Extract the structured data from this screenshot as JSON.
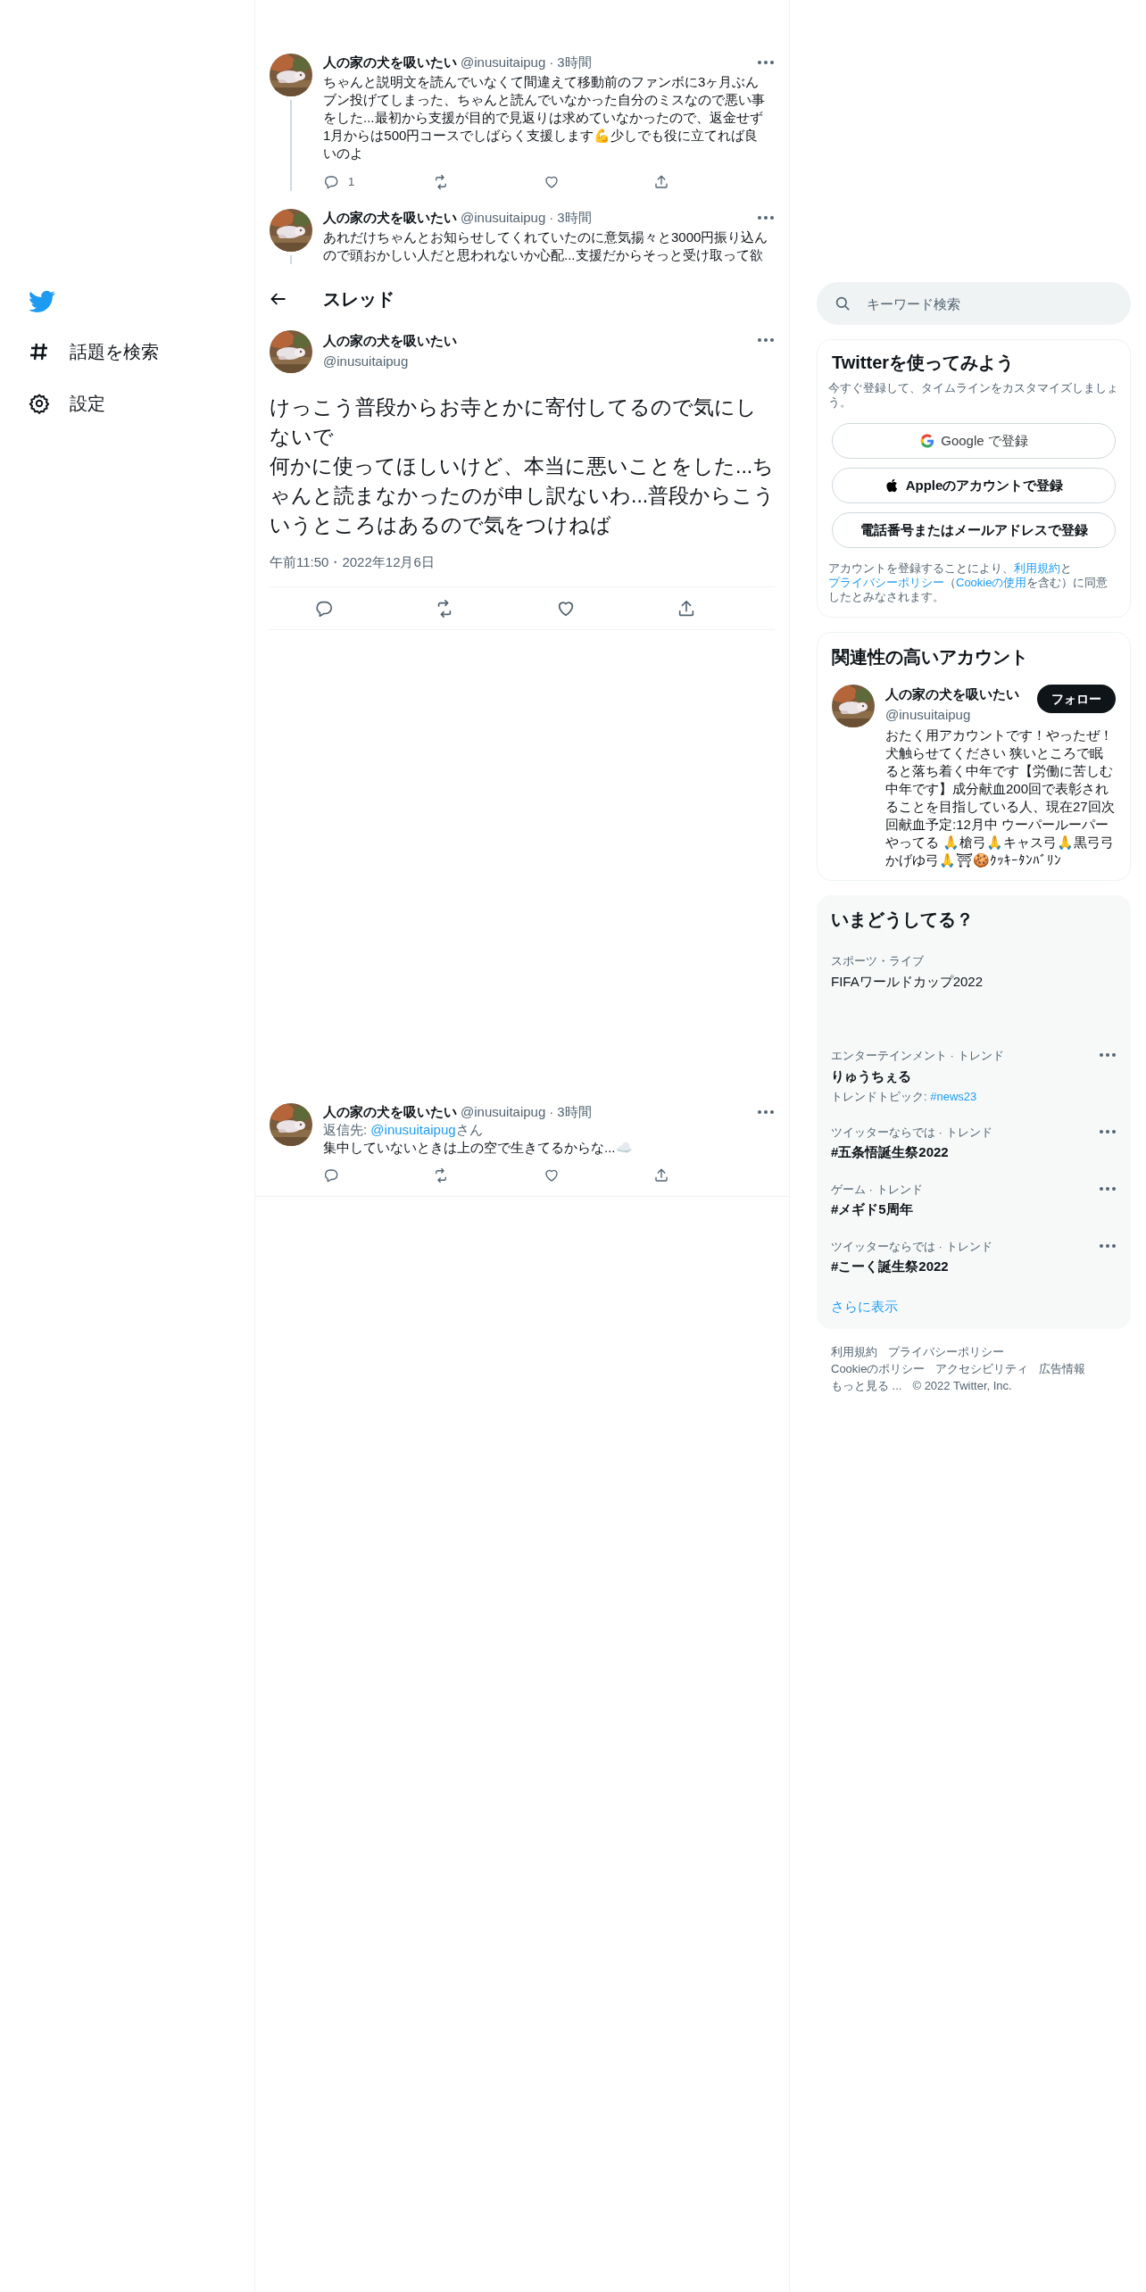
{
  "sidebar": {
    "items": [
      {
        "label": "話題を検索",
        "kind": "hashtag"
      },
      {
        "label": "設定",
        "kind": "settings"
      }
    ]
  },
  "thread_tweets": [
    {
      "name": "人の家の犬を吸いたい",
      "handle": "@inusuitaipug",
      "time": "3時間",
      "separator": "·",
      "text": "ちゃんと説明文を読んでいなくて間違えて移動前のファンボに3ヶ月ぶんブン投げてしまった、ちゃんと読んでいなかった自分のミスなので悪い事をした...最初から支援が目的で見返りは求めていなかったので、返金せず1月からは500円コースでしばらく支援します💪少しでも役に立てれば良いのよ",
      "reply_count": "1"
    },
    {
      "name": "人の家の犬を吸いたい",
      "handle": "@inusuitaipug",
      "time": "3時間",
      "separator": "·",
      "text": "あれだけちゃんとお知らせしてくれていたのに意気揚々と3000円振り込んので頭おかしい人だと思われないか心配...支援だからそっと受け取って欲"
    }
  ],
  "header": {
    "title": "スレッド"
  },
  "main_tweet": {
    "name": "人の家の犬を吸いたい",
    "handle": "@inusuitaipug",
    "paragraphs": [
      "けっこう普段からお寺とかに寄付してるので気にしないで",
      "何かに使ってほしいけど、本当に悪いことをした...ちゃんと読まなかったのが申し訳ないわ...普段からこういうところはあるので気をつけねば"
    ],
    "timestamp": "午前11:50・2022年12月6日"
  },
  "reply_tweet": {
    "name": "人の家の犬を吸いたい",
    "handle": "@inusuitaipug",
    "time": "3時間",
    "separator": "·",
    "reply_prefix": "返信先: ",
    "reply_to": "@inusuitaipug",
    "reply_suffix": "さん",
    "text": "集中していないときは上の空で生きてるからな...☁️"
  },
  "search": {
    "placeholder": "キーワード検索"
  },
  "signup": {
    "title": "Twitterを使ってみよう",
    "subtitle": "今すぐ登録して、タイムラインをカスタマイズしましょう。",
    "buttons": [
      {
        "label": "Google で登録",
        "kind": "google"
      },
      {
        "label": "Appleのアカウントで登録",
        "kind": "apple"
      },
      {
        "label": "電話番号またはメールアドレスで登録",
        "kind": "plain"
      }
    ],
    "legal": [
      {
        "text": "アカウントを登録することにより、",
        "link": false
      },
      {
        "text": "利用規約",
        "link": true
      },
      {
        "text": "と",
        "link": false
      },
      {
        "text": "プライバシーポリシー",
        "link": true
      },
      {
        "text": "（",
        "link": false
      },
      {
        "text": "Cookieの使用",
        "link": true
      },
      {
        "text": "を含む）に同意したとみなされます。",
        "link": false
      }
    ]
  },
  "relevant_accounts": {
    "title": "関連性の高いアカウント",
    "accounts": [
      {
        "name": "人の家の犬を吸いたい",
        "handle": "@inusuitaipug",
        "button": "フォロー",
        "bio": "おたく用アカウントです！やったぜ！犬触らせてください 狭いところで眠ると落ち着く中年です【労働に苦しむ中年です】成分献血200回で表彰されることを目指している人、現在27回次回献血予定:12月中 ウーパールーパーやってる 🙏槍弓🙏キャス弓🙏黒弓弓かげゆ弓🙏⛩🍪ｸｯｷｰﾀﾝﾊﾞﾘﾝ"
      }
    ]
  },
  "trends": {
    "title": "いまどうしてる？",
    "items": [
      {
        "category": "スポーツ・ライブ",
        "title": "FIFAワールドカップ2022",
        "menu": false,
        "bold": false
      },
      {
        "category": "エンターテインメント · トレンド",
        "title": "りゅうちぇる",
        "topic_label": "トレンドトピック: ",
        "topic": "#news23",
        "menu": true,
        "bold": true
      },
      {
        "category": "ツイッターならでは · トレンド",
        "title": "#五条悟誕生祭2022",
        "menu": true,
        "bold": true
      },
      {
        "category": "ゲーム · トレンド",
        "title": "#メギド5周年",
        "menu": true,
        "bold": true
      },
      {
        "category": "ツイッターならでは · トレンド",
        "title": "#こーく誕生祭2022",
        "menu": true,
        "bold": true
      }
    ],
    "show_more": "さらに表示"
  },
  "footer": {
    "links": [
      "利用規約",
      "プライバシーポリシー",
      "Cookieのポリシー",
      "アクセシビリティ",
      "広告情報",
      "もっと見る ..."
    ],
    "copyright": "© 2022 Twitter, Inc."
  }
}
